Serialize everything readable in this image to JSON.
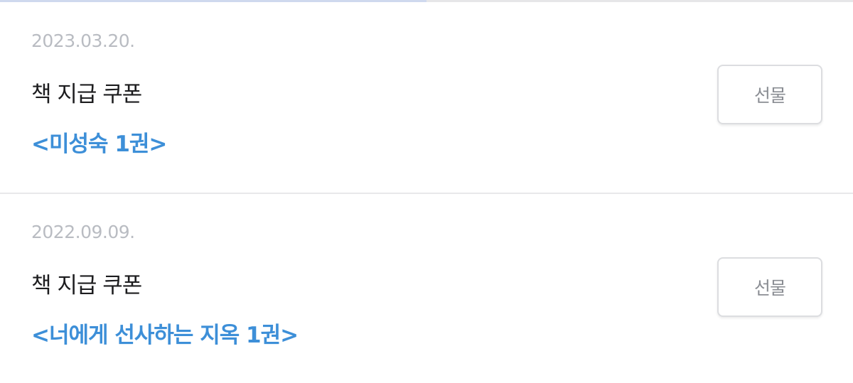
{
  "coupons": [
    {
      "date": "2023.03.20.",
      "title": "책 지급 쿠폰",
      "book": "<미성숙 1권>",
      "gift_label": "선물"
    },
    {
      "date": "2022.09.09.",
      "title": "책 지급 쿠폰",
      "book": "<너에게 선사하는 지옥 1권>",
      "gift_label": "선물"
    }
  ]
}
